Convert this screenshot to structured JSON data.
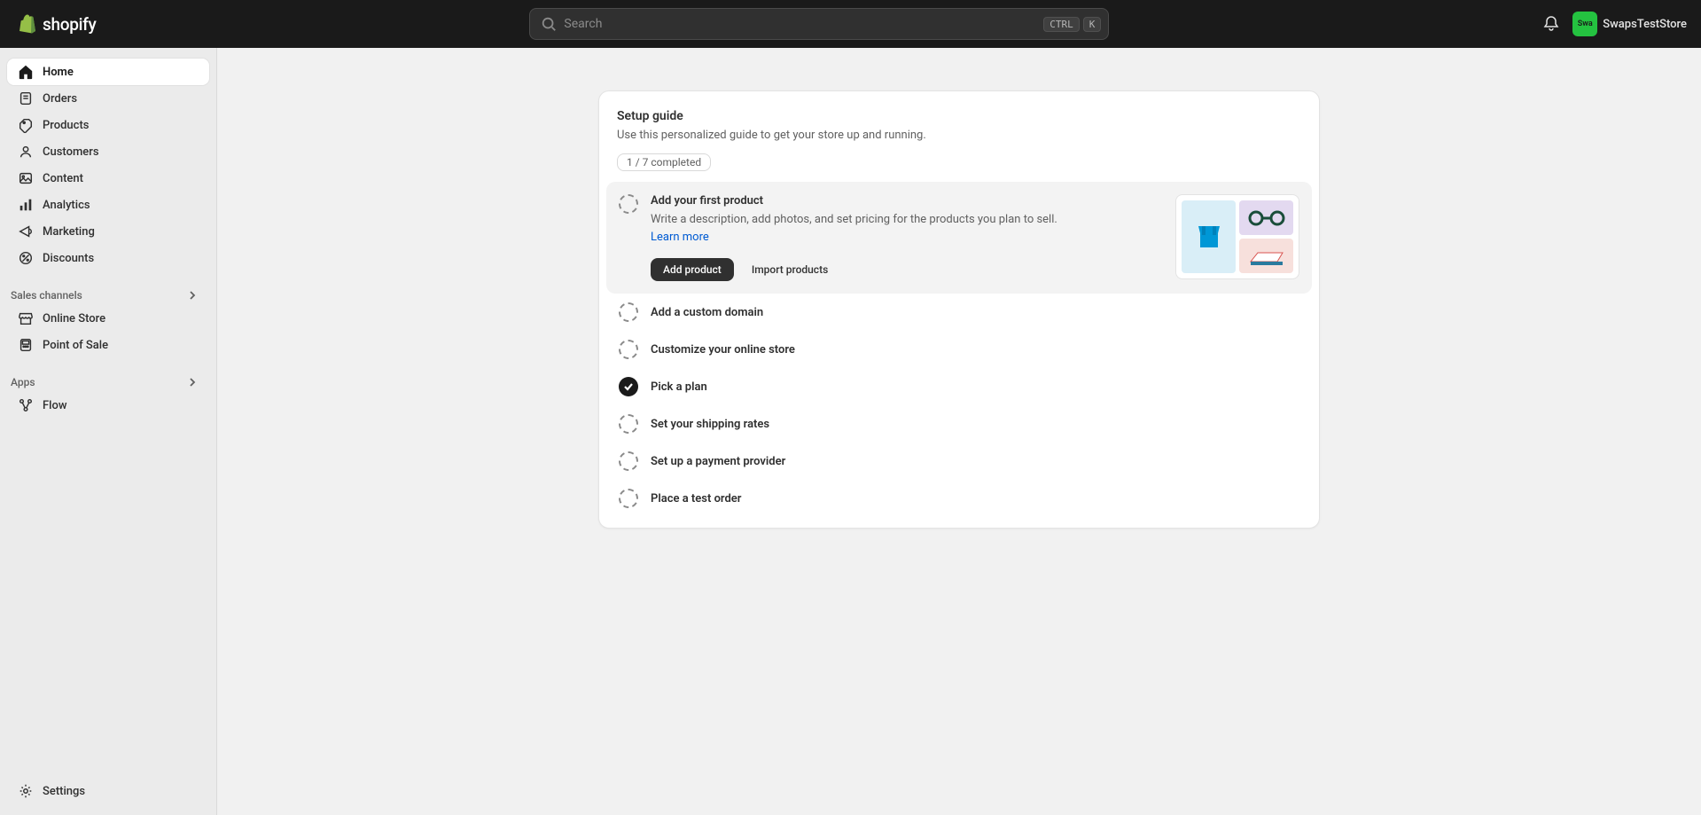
{
  "header": {
    "search_placeholder": "Search",
    "kbd1": "CTRL",
    "kbd2": "K",
    "store_name": "SwapsTestStore",
    "avatar_initials": "Swa"
  },
  "sidebar": {
    "home": "Home",
    "orders": "Orders",
    "products": "Products",
    "customers": "Customers",
    "content": "Content",
    "analytics": "Analytics",
    "marketing": "Marketing",
    "discounts": "Discounts",
    "sales_channels_label": "Sales channels",
    "online_store": "Online Store",
    "point_of_sale": "Point of Sale",
    "apps_label": "Apps",
    "flow": "Flow",
    "settings": "Settings"
  },
  "setup": {
    "title": "Setup guide",
    "subtitle": "Use this personalized guide to get your store up and running.",
    "progress": "1 / 7 completed",
    "expanded": {
      "title": "Add your first product",
      "desc_prefix": "Write a description, add photos, and set pricing for the products you plan to sell. ",
      "learn_more": "Learn more",
      "add_button": "Add product",
      "import_button": "Import products"
    },
    "steps": {
      "custom_domain": "Add a custom domain",
      "customize_store": "Customize your online store",
      "pick_plan": "Pick a plan",
      "shipping": "Set your shipping rates",
      "payment": "Set up a payment provider",
      "test_order": "Place a test order"
    }
  }
}
